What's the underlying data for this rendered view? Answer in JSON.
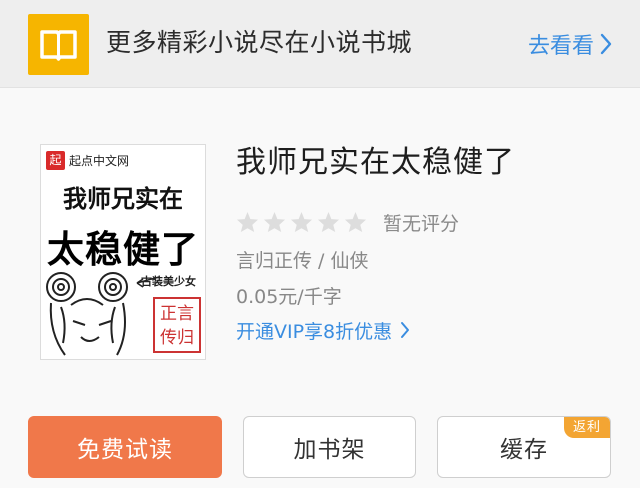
{
  "banner": {
    "icon": "open-book-icon",
    "text": "更多精彩小说尽在小说书城",
    "link_label": "去看看",
    "link_icon": "chevron-right-icon",
    "accent": "#3a8de0",
    "icon_bg": "#f6b500"
  },
  "book": {
    "title": "我师兄实在太稳健了",
    "rating_stars": 5,
    "rating_filled": 0,
    "rating_text": "暂无评分",
    "genre": "言归正传 / 仙侠",
    "price": "0.05元/千字",
    "vip_text": "开通VIP享8折优惠",
    "vip_icon": "chevron-right-icon"
  },
  "cover": {
    "brand_mark": "起",
    "brand": "起点中文网",
    "line1": "我师兄实在",
    "line2": "太稳健了",
    "tag": "古装美少女",
    "seal_top": "正言",
    "seal_bottom": "传归"
  },
  "actions": {
    "read_label": "免费试读",
    "shelf_label": "加书架",
    "cache_label": "缓存",
    "cache_badge": "返利",
    "primary_color": "#f0784a",
    "badge_color": "#f3a533"
  }
}
